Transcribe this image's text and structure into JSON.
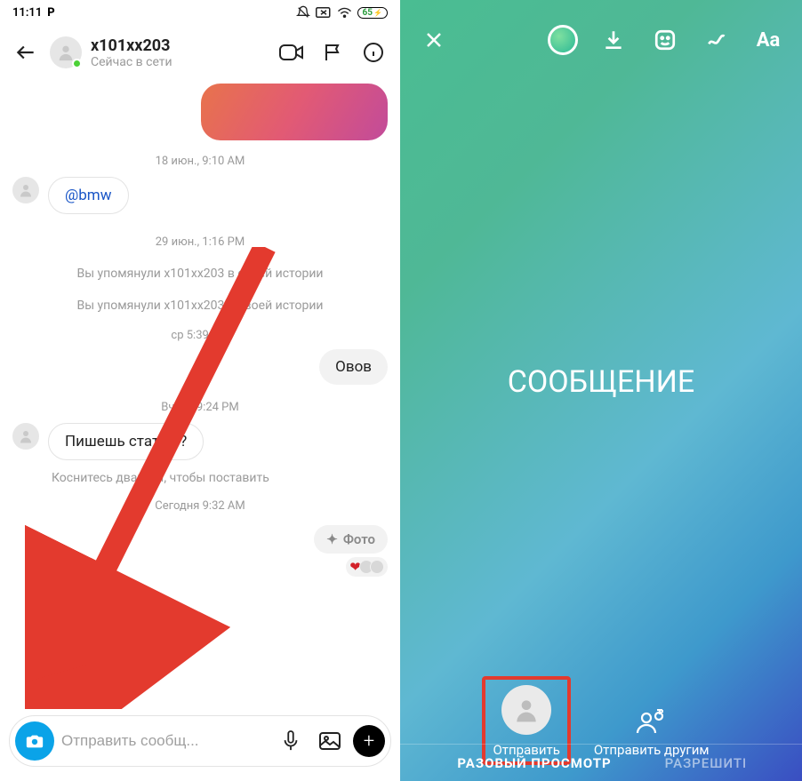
{
  "statusbar": {
    "time": "11:11",
    "app_indicator": "P",
    "battery": "65"
  },
  "chat": {
    "header": {
      "username": "x101xx203",
      "status": "Сейчас в сети"
    },
    "timestamps": {
      "t1": "18 июн., 9:10 AM",
      "t2": "29 июн., 1:16 PM",
      "t3": "ср 5:39 PM",
      "t4": "Вчера 9:24 PM",
      "t5": "Сегодня 9:32 AM"
    },
    "messages": {
      "mention": "@bmw",
      "sysline1": "Вы упомянули x101xx203 в своей истории",
      "sysline2": "Вы упомянули x101xx203 в своей истории",
      "out1": "Овов",
      "in1": "Пишешь статью?",
      "hint": "Коснитесь дважды, чтобы поставить",
      "photo_label": "Фото"
    },
    "input": {
      "placeholder": "Отправить сообщ..."
    }
  },
  "story": {
    "text_tool": "Aa",
    "center_text": "СООБЩЕНИЕ",
    "send": "Отправить",
    "send_others": "Отправить другим",
    "tabs": {
      "active": "РАЗОВЫЙ ПРОСМОТР",
      "inactive": "РАЗРЕШИТЬ"
    }
  }
}
